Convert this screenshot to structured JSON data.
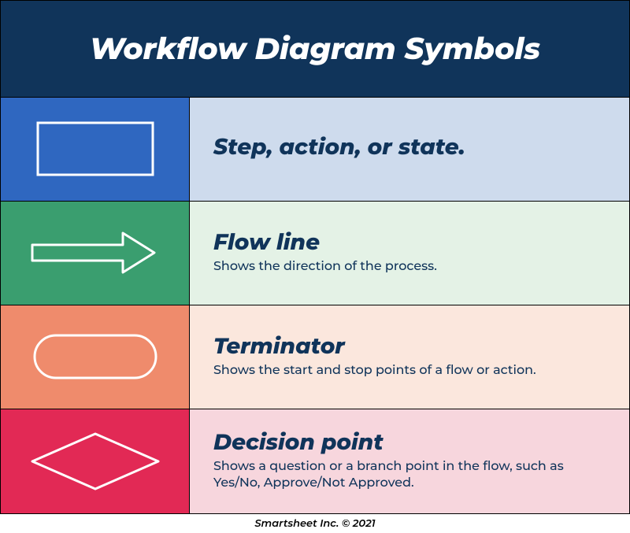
{
  "header": {
    "title": "Workflow Diagram Symbols"
  },
  "rows": {
    "step": {
      "title": "Step, action, or state.",
      "sub": ""
    },
    "flow": {
      "title": "Flow line",
      "sub": "Shows the direction of the process."
    },
    "terminator": {
      "title": "Terminator",
      "sub": "Shows the start and stop points of a flow or action."
    },
    "decision": {
      "title": "Decision point",
      "sub": "Shows a question or a branch point in the flow, such as Yes/No, Approve/Not Approved."
    }
  },
  "footer": {
    "text": "Smartsheet Inc. © 2021"
  },
  "colors": {
    "header_bg": "#10345a",
    "step_dark": "#2f67c0",
    "step_light": "#cedbed",
    "flow_dark": "#3a9e6f",
    "flow_light": "#e4f2e6",
    "term_dark": "#ef8b6c",
    "term_light": "#fbe7dd",
    "dec_dark": "#e22955",
    "dec_light": "#f7d6dd"
  }
}
